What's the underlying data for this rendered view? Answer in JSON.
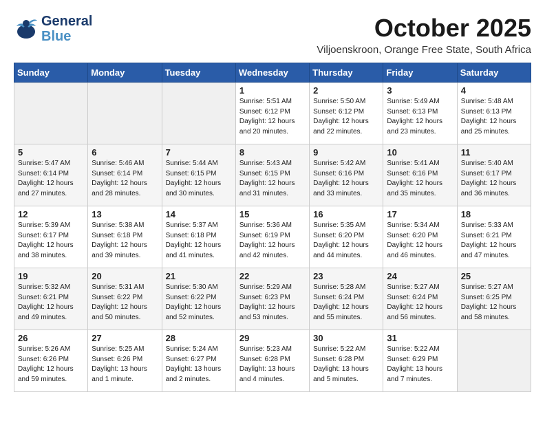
{
  "logo": {
    "line1": "General",
    "line2": "Blue"
  },
  "title": "October 2025",
  "subtitle": "Viljoenskroon, Orange Free State, South Africa",
  "days_of_week": [
    "Sunday",
    "Monday",
    "Tuesday",
    "Wednesday",
    "Thursday",
    "Friday",
    "Saturday"
  ],
  "weeks": [
    [
      {
        "day": "",
        "info": ""
      },
      {
        "day": "",
        "info": ""
      },
      {
        "day": "",
        "info": ""
      },
      {
        "day": "1",
        "info": "Sunrise: 5:51 AM\nSunset: 6:12 PM\nDaylight: 12 hours\nand 20 minutes."
      },
      {
        "day": "2",
        "info": "Sunrise: 5:50 AM\nSunset: 6:12 PM\nDaylight: 12 hours\nand 22 minutes."
      },
      {
        "day": "3",
        "info": "Sunrise: 5:49 AM\nSunset: 6:13 PM\nDaylight: 12 hours\nand 23 minutes."
      },
      {
        "day": "4",
        "info": "Sunrise: 5:48 AM\nSunset: 6:13 PM\nDaylight: 12 hours\nand 25 minutes."
      }
    ],
    [
      {
        "day": "5",
        "info": "Sunrise: 5:47 AM\nSunset: 6:14 PM\nDaylight: 12 hours\nand 27 minutes."
      },
      {
        "day": "6",
        "info": "Sunrise: 5:46 AM\nSunset: 6:14 PM\nDaylight: 12 hours\nand 28 minutes."
      },
      {
        "day": "7",
        "info": "Sunrise: 5:44 AM\nSunset: 6:15 PM\nDaylight: 12 hours\nand 30 minutes."
      },
      {
        "day": "8",
        "info": "Sunrise: 5:43 AM\nSunset: 6:15 PM\nDaylight: 12 hours\nand 31 minutes."
      },
      {
        "day": "9",
        "info": "Sunrise: 5:42 AM\nSunset: 6:16 PM\nDaylight: 12 hours\nand 33 minutes."
      },
      {
        "day": "10",
        "info": "Sunrise: 5:41 AM\nSunset: 6:16 PM\nDaylight: 12 hours\nand 35 minutes."
      },
      {
        "day": "11",
        "info": "Sunrise: 5:40 AM\nSunset: 6:17 PM\nDaylight: 12 hours\nand 36 minutes."
      }
    ],
    [
      {
        "day": "12",
        "info": "Sunrise: 5:39 AM\nSunset: 6:17 PM\nDaylight: 12 hours\nand 38 minutes."
      },
      {
        "day": "13",
        "info": "Sunrise: 5:38 AM\nSunset: 6:18 PM\nDaylight: 12 hours\nand 39 minutes."
      },
      {
        "day": "14",
        "info": "Sunrise: 5:37 AM\nSunset: 6:18 PM\nDaylight: 12 hours\nand 41 minutes."
      },
      {
        "day": "15",
        "info": "Sunrise: 5:36 AM\nSunset: 6:19 PM\nDaylight: 12 hours\nand 42 minutes."
      },
      {
        "day": "16",
        "info": "Sunrise: 5:35 AM\nSunset: 6:20 PM\nDaylight: 12 hours\nand 44 minutes."
      },
      {
        "day": "17",
        "info": "Sunrise: 5:34 AM\nSunset: 6:20 PM\nDaylight: 12 hours\nand 46 minutes."
      },
      {
        "day": "18",
        "info": "Sunrise: 5:33 AM\nSunset: 6:21 PM\nDaylight: 12 hours\nand 47 minutes."
      }
    ],
    [
      {
        "day": "19",
        "info": "Sunrise: 5:32 AM\nSunset: 6:21 PM\nDaylight: 12 hours\nand 49 minutes."
      },
      {
        "day": "20",
        "info": "Sunrise: 5:31 AM\nSunset: 6:22 PM\nDaylight: 12 hours\nand 50 minutes."
      },
      {
        "day": "21",
        "info": "Sunrise: 5:30 AM\nSunset: 6:22 PM\nDaylight: 12 hours\nand 52 minutes."
      },
      {
        "day": "22",
        "info": "Sunrise: 5:29 AM\nSunset: 6:23 PM\nDaylight: 12 hours\nand 53 minutes."
      },
      {
        "day": "23",
        "info": "Sunrise: 5:28 AM\nSunset: 6:24 PM\nDaylight: 12 hours\nand 55 minutes."
      },
      {
        "day": "24",
        "info": "Sunrise: 5:27 AM\nSunset: 6:24 PM\nDaylight: 12 hours\nand 56 minutes."
      },
      {
        "day": "25",
        "info": "Sunrise: 5:27 AM\nSunset: 6:25 PM\nDaylight: 12 hours\nand 58 minutes."
      }
    ],
    [
      {
        "day": "26",
        "info": "Sunrise: 5:26 AM\nSunset: 6:26 PM\nDaylight: 12 hours\nand 59 minutes."
      },
      {
        "day": "27",
        "info": "Sunrise: 5:25 AM\nSunset: 6:26 PM\nDaylight: 13 hours\nand 1 minute."
      },
      {
        "day": "28",
        "info": "Sunrise: 5:24 AM\nSunset: 6:27 PM\nDaylight: 13 hours\nand 2 minutes."
      },
      {
        "day": "29",
        "info": "Sunrise: 5:23 AM\nSunset: 6:28 PM\nDaylight: 13 hours\nand 4 minutes."
      },
      {
        "day": "30",
        "info": "Sunrise: 5:22 AM\nSunset: 6:28 PM\nDaylight: 13 hours\nand 5 minutes."
      },
      {
        "day": "31",
        "info": "Sunrise: 5:22 AM\nSunset: 6:29 PM\nDaylight: 13 hours\nand 7 minutes."
      },
      {
        "day": "",
        "info": ""
      }
    ]
  ]
}
